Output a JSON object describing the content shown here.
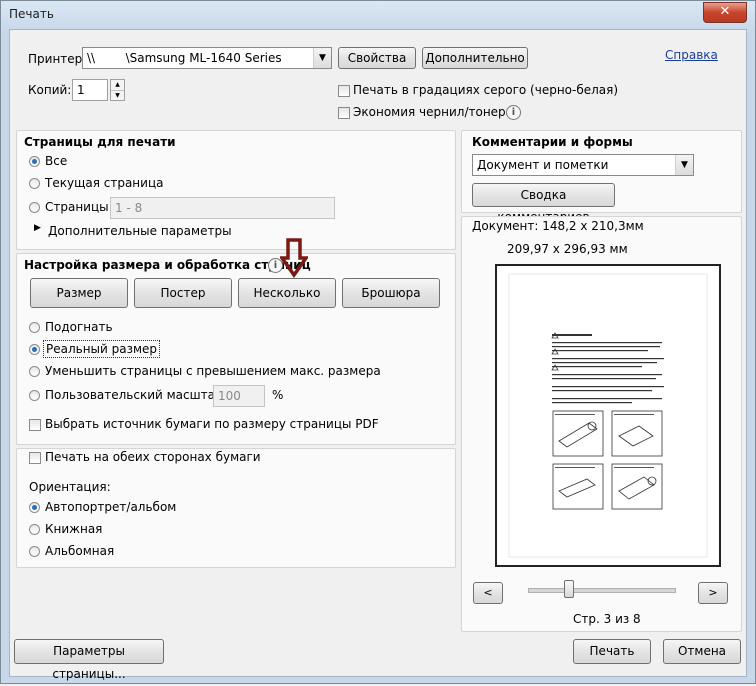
{
  "window": {
    "title": "Печать",
    "close_label": "✕"
  },
  "printer": {
    "label": "Принтер:",
    "selected": "\\\\        \\Samsung ML-1640 Series",
    "properties_button": "Свойства",
    "advanced_button": "Дополнительно",
    "help_link": "Справка",
    "copies_label": "Копий:",
    "copies_value": "1",
    "grayscale_label": "Печать в градациях серого (черно-белая)",
    "save_ink_label": "Экономия чернил/тонера"
  },
  "pages": {
    "header": "Страницы для печати",
    "all_label": "Все",
    "current_label": "Текущая страница",
    "range_label": "Страницы",
    "range_value": "1 - 8",
    "more_options_label": "Дополнительные параметры"
  },
  "sizing": {
    "header": "Настройка размера и обработка страниц",
    "tabs": [
      "Размер",
      "Постер",
      "Несколько",
      "Брошюра"
    ],
    "fit_label": "Подогнать",
    "actual_label": "Реальный размер",
    "shrink_label": "Уменьшить страницы с превышением макс. размера",
    "custom_label": "Пользовательский масштаб:",
    "custom_value": "100",
    "percent": "%",
    "paper_source_label": "Выбрать источник бумаги по размеру страницы PDF"
  },
  "duplex": {
    "both_sides_label": "Печать на обеих сторонах бумаги",
    "orientation_header": "Ориентация:",
    "auto_label": "Автопортрет/альбом",
    "portrait_label": "Книжная",
    "landscape_label": "Альбомная"
  },
  "comments": {
    "header": "Комментарии и формы",
    "selected": "Документ и пометки",
    "summary_button": "Сводка комментариев"
  },
  "preview": {
    "doc_size": "Документ: 148,2 x 210,3мм",
    "paper_size": "209,97 x 296,93 мм",
    "prev": "<",
    "next": ">",
    "page_status": "Стр. 3 из 8"
  },
  "footer": {
    "page_setup_button": "Параметры страницы...",
    "print_button": "Печать",
    "cancel_button": "Отмена"
  },
  "colors": {
    "accent": "#2c6cb8",
    "arrow": "#7b1a12"
  }
}
